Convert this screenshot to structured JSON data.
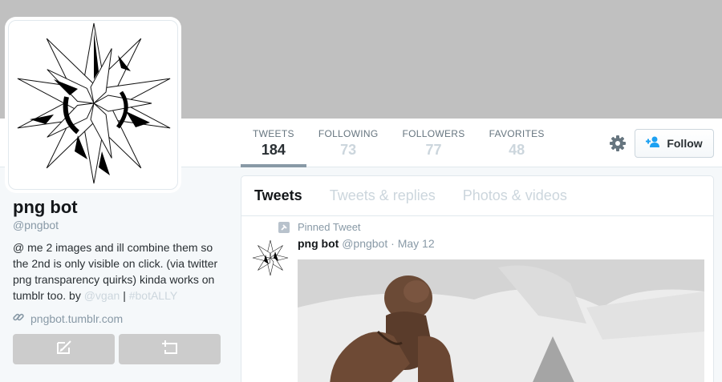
{
  "profile": {
    "name": "png bot",
    "handle": "@pngbot",
    "bio": {
      "text": "@ me 2 images and ill combine them so the 2nd is only visible on click. (via twitter png transparency quirks) kinda works on tumblr too. by",
      "mention": "@vgan",
      "separator": "|",
      "hashtag": "#botALLY"
    },
    "website": "pngbot.tumblr.com"
  },
  "stats": [
    {
      "label": "TWEETS",
      "value": "184"
    },
    {
      "label": "FOLLOWING",
      "value": "73"
    },
    {
      "label": "FOLLOWERS",
      "value": "77"
    },
    {
      "label": "FAVORITES",
      "value": "48"
    }
  ],
  "actions": {
    "follow_label": "Follow",
    "settings_icon": "gear-icon",
    "message_icon": "compose-message-icon",
    "list_icon": "add-to-list-icon"
  },
  "timeline": {
    "tabs": [
      "Tweets",
      "Tweets & replies",
      "Photos & videos"
    ],
    "pinned_label": "Pinned Tweet",
    "tweet": {
      "name": "png bot",
      "handle": "@pngbot",
      "separator": "·",
      "date": "May 12"
    }
  },
  "colors": {
    "banner": "#c0c0c0",
    "accent": "#1da1f2",
    "muted": "#8899a6"
  }
}
